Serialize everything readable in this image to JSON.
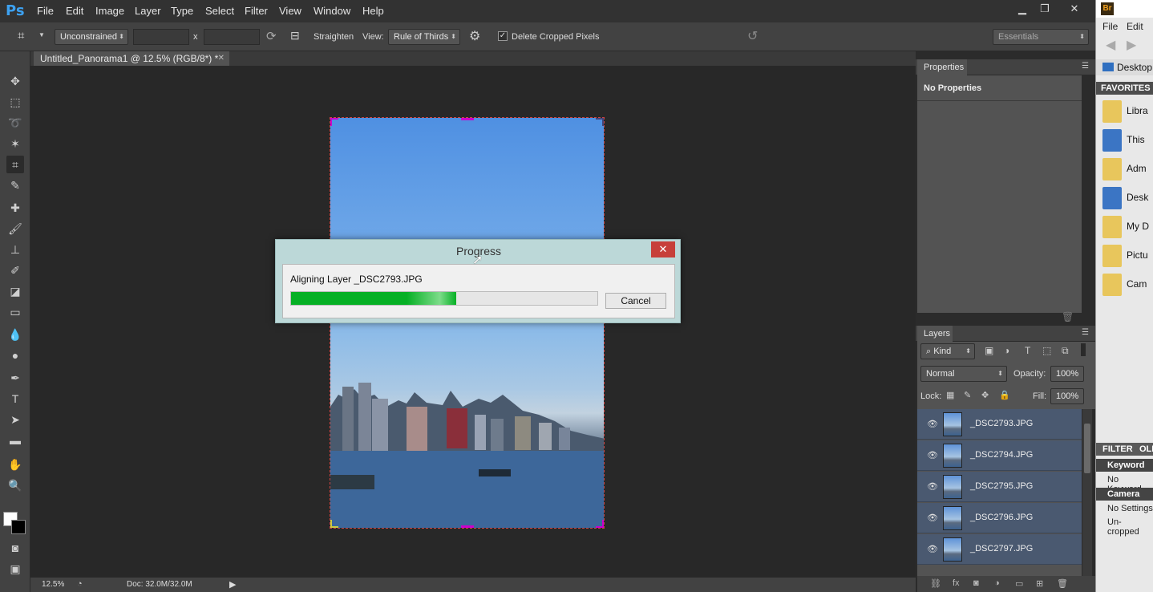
{
  "app": {
    "logo": "Ps"
  },
  "menu": [
    "File",
    "Edit",
    "Image",
    "Layer",
    "Type",
    "Select",
    "Filter",
    "View",
    "Window",
    "Help"
  ],
  "window_controls": {
    "minimize": "▁",
    "restore": "❐",
    "close": "✕"
  },
  "options": {
    "ratio": "Unconstrained",
    "x_sep": "x",
    "straighten": "Straighten",
    "view_label": "View:",
    "view_value": "Rule of Thirds",
    "delete_cropped": "Delete Cropped Pixels",
    "delete_cropped_checked": "✓",
    "workspace": "Essentials"
  },
  "document": {
    "tab_title": "Untitled_Panorama1 @ 12.5% (RGB/8*) *",
    "tab_close": "✕"
  },
  "status": {
    "zoom": "12.5%",
    "doc_info": "Doc: 32.0M/32.0M"
  },
  "dialog": {
    "title": "Progress",
    "message": "Aligning Layer _DSC2793.JPG",
    "progress": 0.54,
    "cancel_label": "Cancel",
    "close_glyph": "✕"
  },
  "properties": {
    "tab": "Properties",
    "empty": "No Properties"
  },
  "layers": {
    "tab": "Layers",
    "filter_kind": "Kind",
    "blend_mode": "Normal",
    "opacity_label": "Opacity:",
    "opacity_value": "100%",
    "lock_label": "Lock:",
    "fill_label": "Fill:",
    "fill_value": "100%",
    "items": [
      "_DSC2793.JPG",
      "_DSC2794.JPG",
      "_DSC2795.JPG",
      "_DSC2796.JPG",
      "_DSC2797.JPG"
    ]
  },
  "bridge": {
    "logo": "Br",
    "menu": [
      "File",
      "Edit"
    ],
    "path": "Desktop",
    "favorites_header": "FAVORITES",
    "favorites": [
      "Libra",
      "This",
      "Adm",
      "Desk",
      "My D",
      "Pictu",
      "Cam"
    ],
    "filter_tab": "FILTER",
    "filter_tab2": "OLL",
    "keywords_header": "Keyword",
    "keywords_value": "No Keyword",
    "camera_header": "Camera",
    "camera_value1": "No Settings",
    "camera_value2": "Un-cropped"
  }
}
